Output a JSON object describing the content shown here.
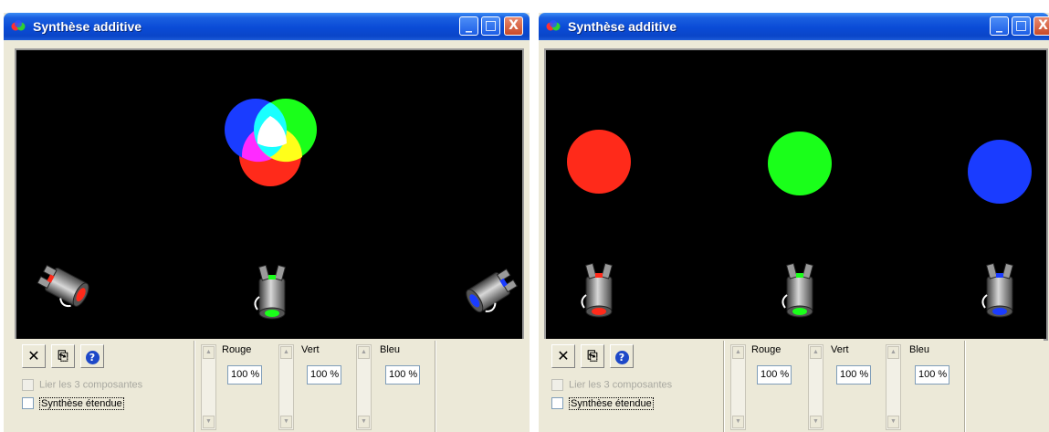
{
  "windows": [
    {
      "title": "Synthèse additive",
      "controls": {
        "minimize": "_",
        "maximize": "□",
        "close": "X"
      },
      "toolbar": {
        "close_glyph": "✕",
        "copy_glyph": "⎘",
        "help_glyph": "?"
      },
      "options": {
        "link_components": {
          "label": "Lier les 3 composantes",
          "checked": false,
          "enabled": false
        },
        "extended": {
          "label": "Synthèse étendue",
          "checked": false,
          "enabled": true
        }
      },
      "channels": [
        {
          "label": "Rouge",
          "value": "100 %"
        },
        {
          "label": "Vert",
          "value": "100 %"
        },
        {
          "label": "Bleu",
          "value": "100 %"
        }
      ],
      "scene": "overlapping-beams",
      "beam_colors": {
        "red": "#ff2a1a",
        "green": "#1aff1a",
        "blue": "#1a3cff"
      }
    },
    {
      "title": "Synthèse additive",
      "controls": {
        "minimize": "_",
        "maximize": "□",
        "close": "X"
      },
      "toolbar": {
        "close_glyph": "✕",
        "copy_glyph": "⎘",
        "help_glyph": "?"
      },
      "options": {
        "link_components": {
          "label": "Lier les 3 composantes",
          "checked": false,
          "enabled": false
        },
        "extended": {
          "label": "Synthèse étendue",
          "checked": false,
          "enabled": true
        }
      },
      "channels": [
        {
          "label": "Rouge",
          "value": "100 %"
        },
        {
          "label": "Vert",
          "value": "100 %"
        },
        {
          "label": "Bleu",
          "value": "100 %"
        }
      ],
      "scene": "separate-beams",
      "beam_colors": {
        "red": "#ff2a1a",
        "green": "#1aff1a",
        "blue": "#1a3cff"
      }
    }
  ],
  "colors": {
    "titlebar": "#0a4bd6",
    "stage_background": "#000000",
    "panel_background": "#ECE9D8",
    "spot_body": "#8a8a8a"
  }
}
